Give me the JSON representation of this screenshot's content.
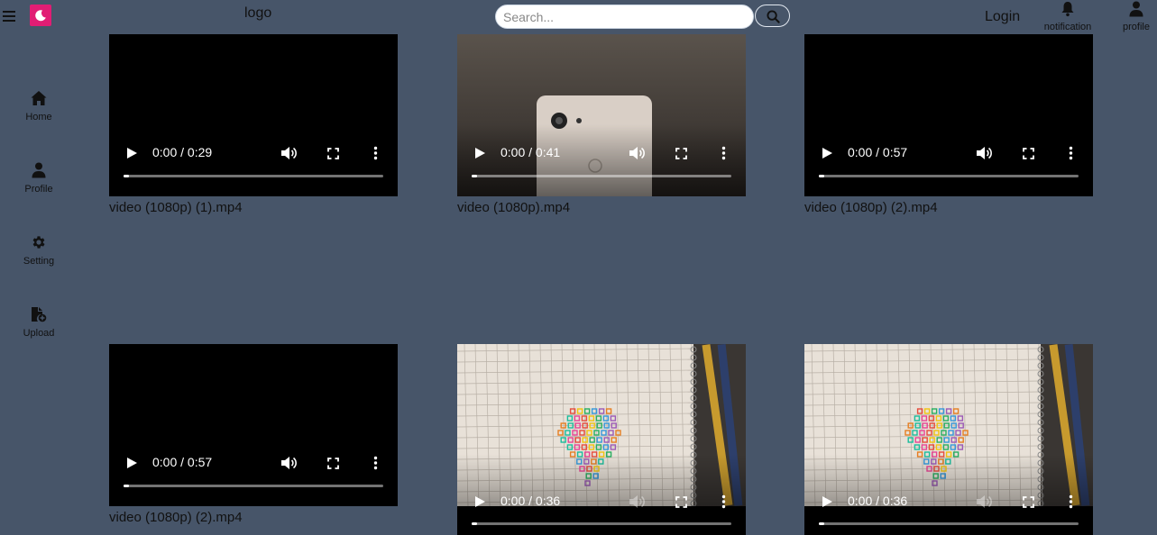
{
  "header": {
    "logo_text": "logo",
    "search_placeholder": "Search...",
    "login_label": "Login",
    "notification_label": "notification",
    "profile_label": "profile",
    "brand_color": "#e11d74"
  },
  "sidebar": {
    "items": [
      {
        "label": "Home",
        "icon": "home-icon"
      },
      {
        "label": "Profile",
        "icon": "user-icon"
      },
      {
        "label": "Setting",
        "icon": "gear-icon"
      },
      {
        "label": "Upload",
        "icon": "file-upload-icon"
      }
    ]
  },
  "videos": [
    {
      "title": "video (1080p) (1).mp4",
      "time": "0:00 / 0:29",
      "poster": "black",
      "progress": 0.02
    },
    {
      "title": "video (1080p).mp4",
      "time": "0:00 / 0:41",
      "poster": "phone",
      "progress": 0.02
    },
    {
      "title": "video (1080p) (2).mp4",
      "time": "0:00 / 0:57",
      "poster": "black",
      "progress": 0.02
    },
    {
      "title": "video (1080p) (2).mp4",
      "time": "0:00 / 0:57",
      "poster": "black",
      "progress": 0.02
    },
    {
      "title": "",
      "time": "0:00 / 0:36",
      "poster": "notebook",
      "progress": 0.02
    },
    {
      "title": "",
      "time": "0:00 / 0:36",
      "poster": "notebook",
      "progress": 0.02
    }
  ],
  "colors": {
    "background": "#475569"
  }
}
